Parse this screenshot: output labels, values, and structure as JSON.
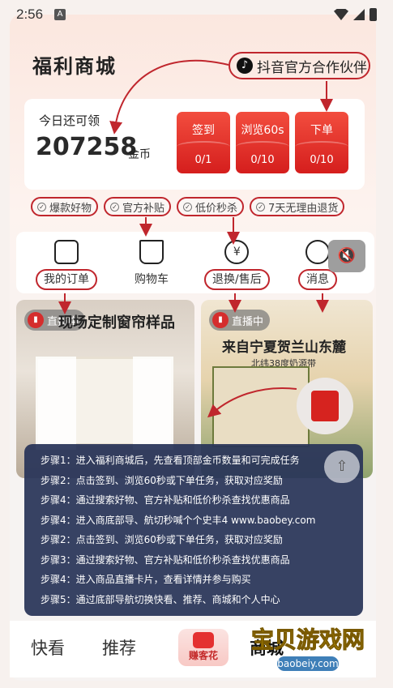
{
  "status": {
    "time": "2:56",
    "app_icon": "A"
  },
  "header": {
    "title": "福利商城",
    "partner_label": "抖音官方合作伙伴"
  },
  "coins": {
    "label": "今日还可领",
    "value": "207258",
    "unit": "金币"
  },
  "tasks": [
    {
      "name": "签到",
      "count": "0/1"
    },
    {
      "name": "浏览60s",
      "count": "0/10"
    },
    {
      "name": "下单",
      "count": "0/10"
    }
  ],
  "tags": [
    "爆款好物",
    "官方补贴",
    "低价秒杀",
    "7天无理由退货"
  ],
  "nav": [
    "我的订单",
    "购物车",
    "退换/售后",
    "消息"
  ],
  "live": [
    {
      "badge": "直播中",
      "title": "现场定制窗帘样品"
    },
    {
      "badge": "直播中",
      "title": "来自宁夏贺兰山东麓",
      "sub": "北纬38度奶源带"
    }
  ],
  "steps": [
    "步骤1：进入福利商城后，先查看顶部金币数量和可完成任务",
    "步骤2：点击签到、浏览60秒或下单任务，获取对应奖励",
    "步骤4：通过搜索好物、官方补贴和低价秒杀查找优惠商品",
    "步骤4：进入商底部导、航切秒喊个个史丰4 www.baobey.com",
    "步骤2：点击签到、浏览60秒或下单任务，获取对应奖励",
    "步骤3：通过搜索好物、官方补贴和低价秒杀查找优惠商品",
    "步骤4：进入商品直播卡片，查看详情并参与购买",
    "步骤5：通过底部导航切换快看、推荐、商城和个人中心"
  ],
  "tabbar": {
    "tab1": "快看",
    "tab2": "推荐",
    "center": "赚客花",
    "tab3": "商城"
  },
  "watermark": {
    "text": "宝贝游戏网",
    "url": "baobeiy.com"
  },
  "colors": {
    "accent": "#c0262d",
    "task_red": "#e0302a",
    "overlay": "#283458"
  }
}
